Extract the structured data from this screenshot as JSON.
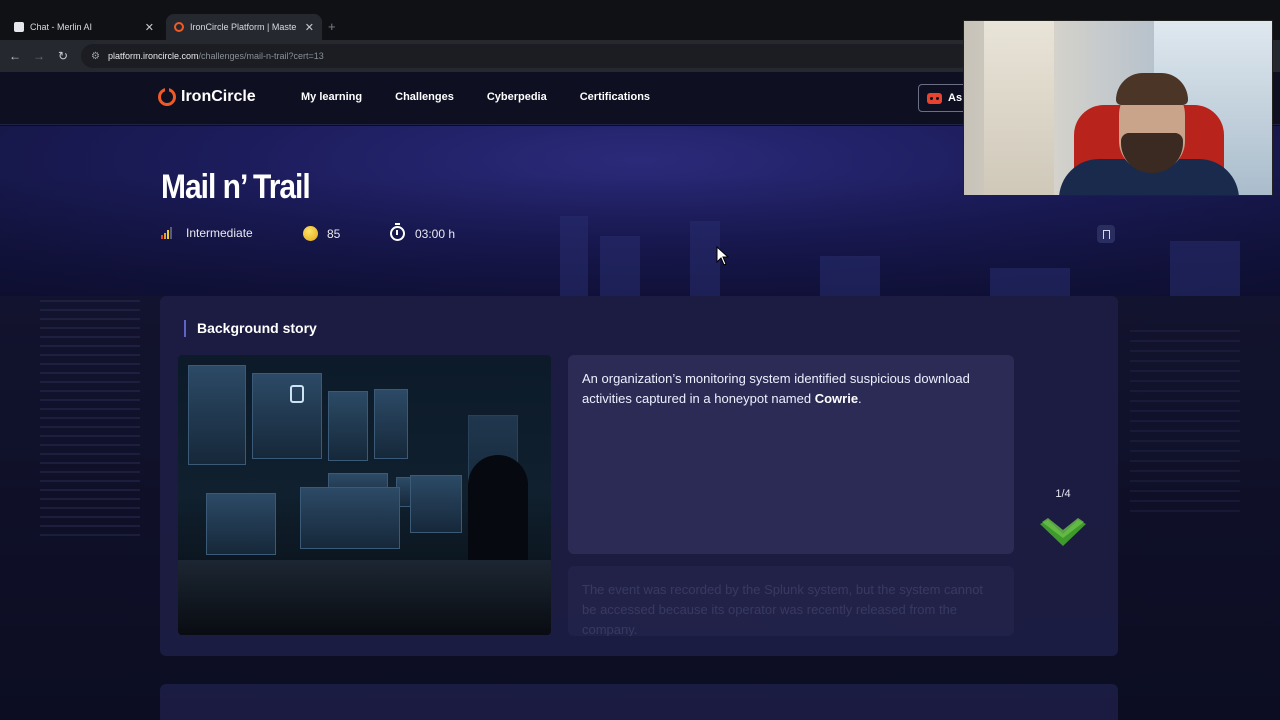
{
  "browser": {
    "tabs": [
      {
        "title": "Chat - Merlin AI",
        "active": false
      },
      {
        "title": "IronCircle Platform | Master yo",
        "active": true
      }
    ],
    "url_host": "platform.ironcircle.com",
    "url_path": "/challenges/mail-n-trail?cert=13"
  },
  "header": {
    "logo": "IronCircle",
    "nav": [
      "My learning",
      "Challenges",
      "Cyberpedia",
      "Certifications"
    ],
    "assistant_label": "As"
  },
  "challenge": {
    "title": "Mail n’ Trail",
    "level": "Intermediate",
    "points": "85",
    "duration": "03:00 h"
  },
  "background_story": {
    "heading": "Background story",
    "paragraph1_pre": "An organization’s monitoring system identified suspicious download activities captured in a honeypot named ",
    "paragraph1_bold": "Cowrie",
    "paragraph1_post": ".",
    "paragraph2": "The event was recorded by the Splunk system, but the system cannot be accessed because its operator was recently released from the company.",
    "pager": "1/4"
  },
  "colors": {
    "accent": "#f15a24",
    "hero_bg": "#1c1c5c",
    "panel_bg": "#1e1f46",
    "chevron": "#4caf3a"
  }
}
